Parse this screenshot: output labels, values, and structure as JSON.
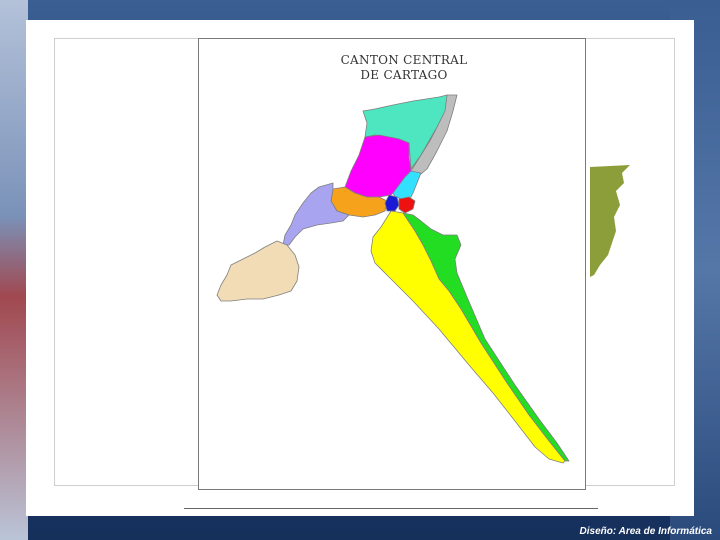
{
  "map": {
    "title_line1": "CANTON CENTRAL",
    "title_line2": "DE CARTAGO",
    "regions": [
      {
        "name": "north-teal-district",
        "color": "#4de6c0"
      },
      {
        "name": "north-gray-strip",
        "color": "#bdbdbd"
      },
      {
        "name": "magenta-district",
        "color": "#ff00ff"
      },
      {
        "name": "cyan-district",
        "color": "#33e0ff"
      },
      {
        "name": "lavender-district",
        "color": "#a9a4f0"
      },
      {
        "name": "orange-district",
        "color": "#f7a21b"
      },
      {
        "name": "navy-district",
        "color": "#1a1ad6"
      },
      {
        "name": "red-district",
        "color": "#ee1111"
      },
      {
        "name": "tan-district",
        "color": "#f2dcb5"
      },
      {
        "name": "yellow-district",
        "color": "#ffff00"
      },
      {
        "name": "green-district",
        "color": "#22dd22"
      }
    ]
  },
  "background_shape_color": "#8b9e3a",
  "footer": {
    "credit": "Diseño: Area de Informática"
  }
}
